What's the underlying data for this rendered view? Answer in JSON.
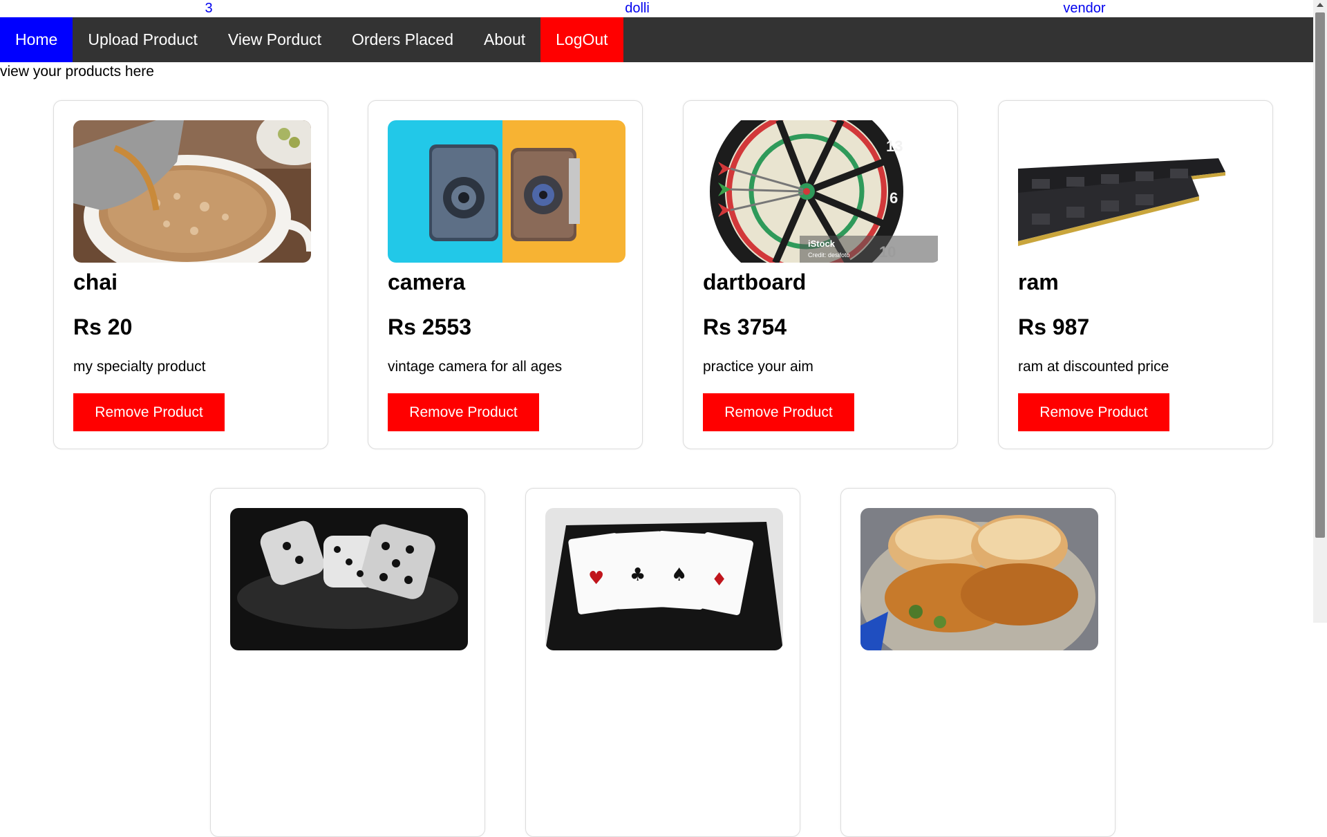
{
  "header": {
    "count": "3",
    "username": "dolli",
    "role": "vendor"
  },
  "nav": {
    "home": "Home",
    "upload": "Upload Product",
    "view": "View Porduct",
    "orders": "Orders Placed",
    "about": "About",
    "logout": "LogOut"
  },
  "intro": "view your products here",
  "products": [
    {
      "name": "chai",
      "price": "Rs 20",
      "description": "my specialty product",
      "button": "Remove Product",
      "image": "chai-image"
    },
    {
      "name": "camera",
      "price": "Rs 2553",
      "description": "vintage camera for all ages",
      "button": "Remove Product",
      "image": "camera-image"
    },
    {
      "name": "dartboard",
      "price": "Rs 3754",
      "description": "practice your aim",
      "button": "Remove Product",
      "image": "dartboard-image",
      "watermark": "iStock",
      "watermark_credit": "Credit: desifoto"
    },
    {
      "name": "ram",
      "price": "Rs 987",
      "description": "ram at discounted price",
      "button": "Remove Product",
      "image": "ram-image"
    },
    {
      "image": "dice-image"
    },
    {
      "image": "cards-image"
    },
    {
      "image": "vadapav-image"
    }
  ],
  "colors": {
    "nav_bg": "#333333",
    "active": "#0000ff",
    "danger": "#ff0000",
    "link": "#0000ee"
  }
}
